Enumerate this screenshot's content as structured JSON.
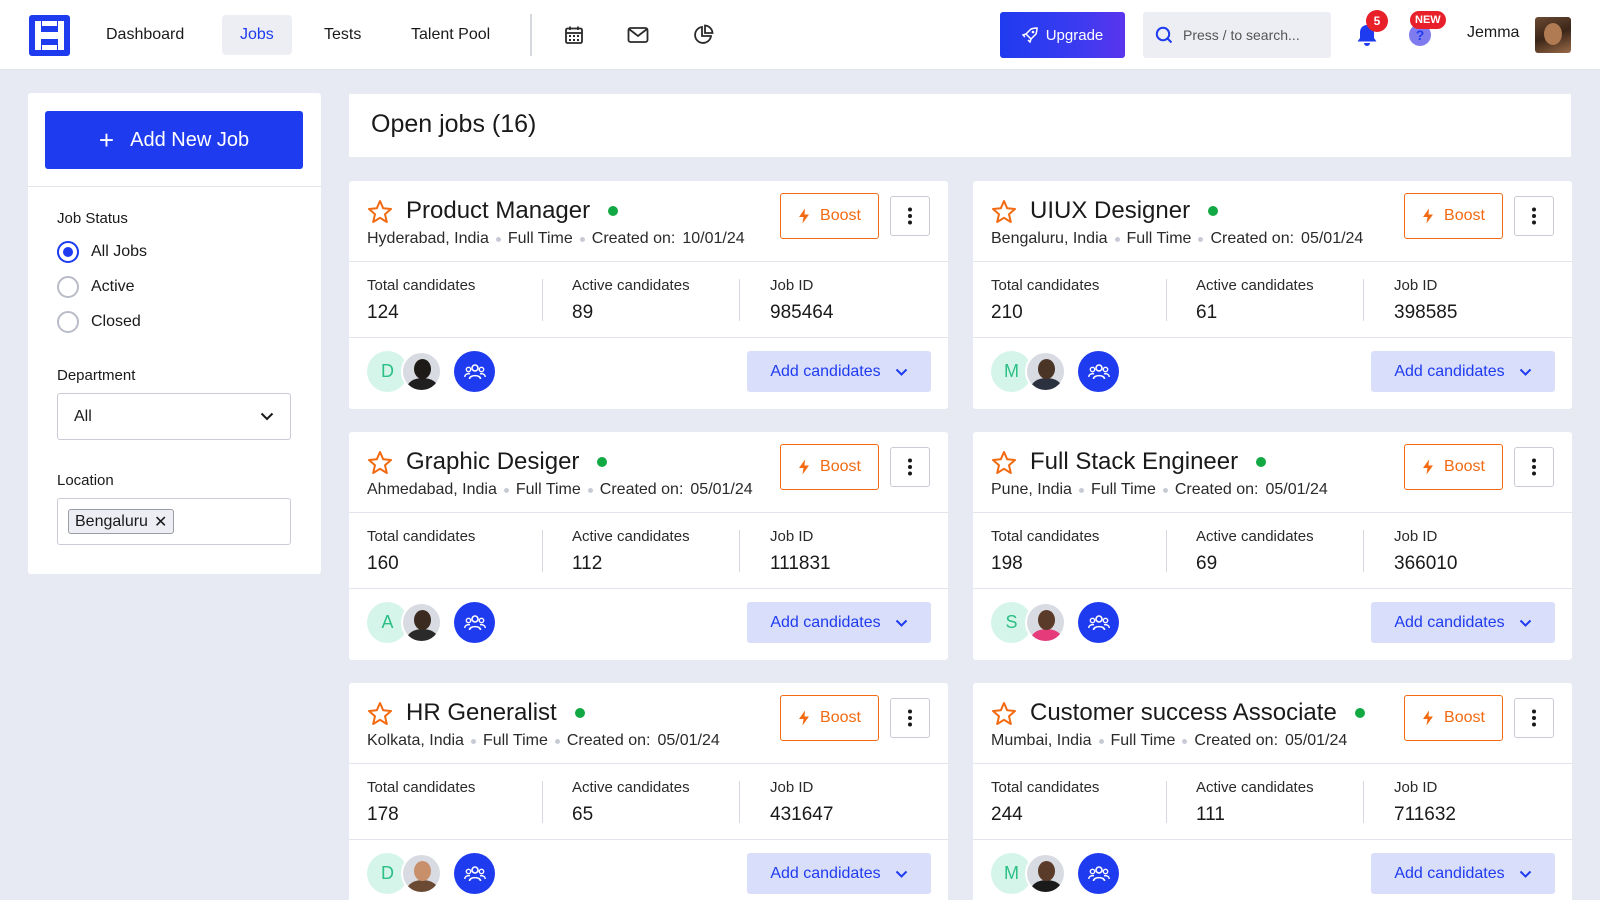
{
  "nav": {
    "items": [
      {
        "label": "Dashboard",
        "active": false
      },
      {
        "label": "Jobs",
        "active": true
      },
      {
        "label": "Tests",
        "active": false
      },
      {
        "label": "Talent Pool",
        "active": false
      }
    ],
    "tools": [
      "calendar-icon",
      "mail-icon",
      "pie-chart-icon"
    ],
    "upgrade_label": "Upgrade",
    "search_placeholder": "Press / to search...",
    "notification_count": "5",
    "help_badge": "NEW",
    "help_glyph": "?",
    "username": "Jemma"
  },
  "sidebar": {
    "add_job_label": "Add New Job",
    "job_status_label": "Job Status",
    "status_options": [
      {
        "label": "All Jobs",
        "checked": true
      },
      {
        "label": "Active",
        "checked": false
      },
      {
        "label": "Closed",
        "checked": false
      }
    ],
    "department_label": "Department",
    "department_value": "All",
    "location_label": "Location",
    "location_chip": "Bengaluru"
  },
  "main": {
    "title": "Open jobs (16)",
    "boost_label": "Boost",
    "add_candidates_label": "Add candidates",
    "stat_labels": {
      "total": "Total candidates",
      "active": "Active candidates",
      "job_id": "Job ID"
    },
    "created_prefix": "Created on:",
    "jobs": [
      {
        "title": "Product Manager",
        "location": "Hyderabad, India",
        "type": "Full Time",
        "created": "10/01/24",
        "total": "124",
        "active": "89",
        "job_id": "985464",
        "avatar_letter": "D",
        "status_color": "#12a844"
      },
      {
        "title": "UIUX Designer",
        "location": "Bengaluru, India",
        "type": "Full Time",
        "created": "05/01/24",
        "total": "210",
        "active": "61",
        "job_id": "398585",
        "avatar_letter": "M",
        "status_color": "#12a844"
      },
      {
        "title": "Graphic Desiger",
        "location": "Ahmedabad, India",
        "type": "Full Time",
        "created": "05/01/24",
        "total": "160",
        "active": "112",
        "job_id": "111831",
        "avatar_letter": "A",
        "status_color": "#12a844"
      },
      {
        "title": "Full Stack Engineer",
        "location": "Pune, India",
        "type": "Full Time",
        "created": "05/01/24",
        "total": "198",
        "active": "69",
        "job_id": "366010",
        "avatar_letter": "S",
        "status_color": "#12a844"
      },
      {
        "title": "HR Generalist",
        "location": "Kolkata, India",
        "type": "Full Time",
        "created": "05/01/24",
        "total": "178",
        "active": "65",
        "job_id": "431647",
        "avatar_letter": "D",
        "status_color": "#12a844"
      },
      {
        "title": "Customer success Associate",
        "location": "Mumbai, India",
        "type": "Full Time",
        "created": "05/01/24",
        "total": "244",
        "active": "111",
        "job_id": "711632",
        "avatar_letter": "M",
        "status_color": "#12a844"
      }
    ]
  },
  "colors": {
    "primary": "#1f3bef",
    "boost": "#f26a12",
    "active_dot": "#12a844",
    "badge": "#e8202a"
  }
}
